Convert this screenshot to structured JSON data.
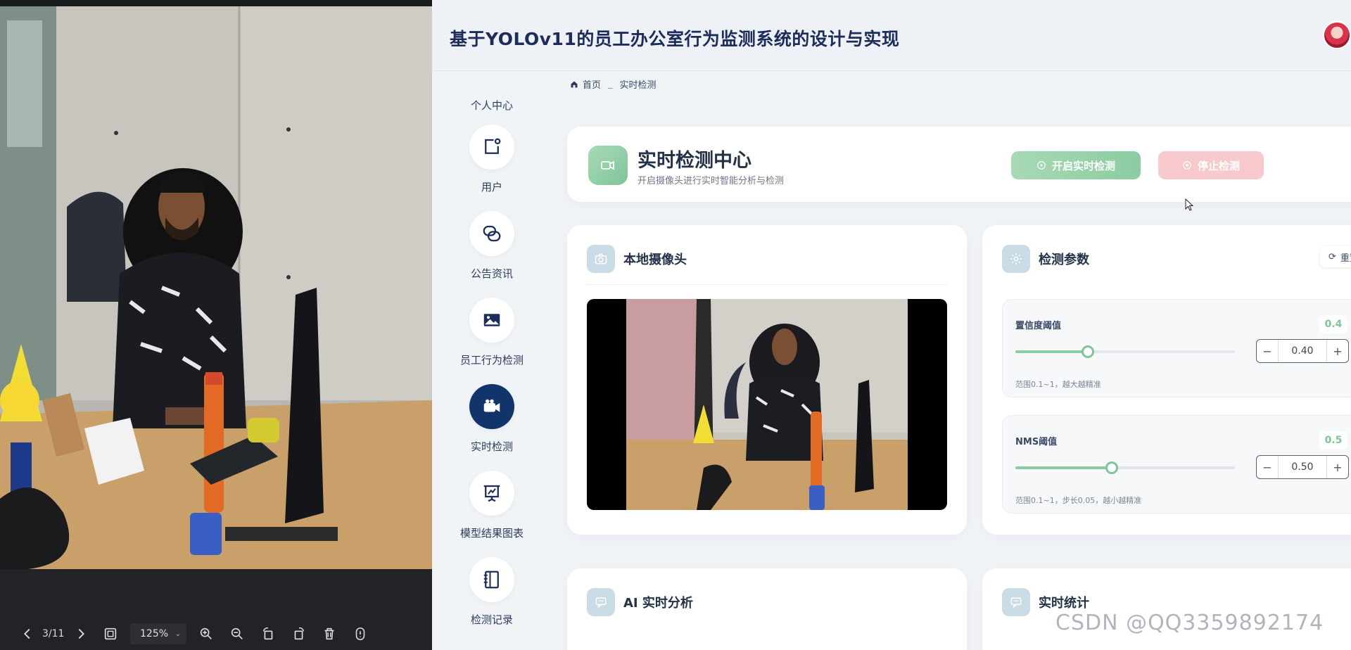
{
  "viewer": {
    "page_indicator": "3/11",
    "zoom": "125%",
    "toolbar_icons": [
      "chevron-left-icon",
      "chevron-right-icon",
      "fit-screen-icon",
      "zoom-in-icon",
      "zoom-out-icon",
      "rotate-left-icon",
      "rotate-right-icon",
      "delete-icon",
      "info-icon"
    ]
  },
  "header": {
    "title": "基于YOLOv11的员工办公室行为监测系统的设计与实现"
  },
  "sidebar": {
    "personal": "个人中心",
    "items": [
      {
        "label": "用户",
        "icon": "user-edit-icon",
        "active": false
      },
      {
        "label": "公告资讯",
        "icon": "link-icon",
        "active": false
      },
      {
        "label": "员工行为检测",
        "icon": "image-icon",
        "active": false
      },
      {
        "label": "实时检测",
        "icon": "video-camera-icon",
        "active": true
      },
      {
        "label": "模型结果图表",
        "icon": "presentation-chart-icon",
        "active": false
      },
      {
        "label": "检测记录",
        "icon": "notebook-icon",
        "active": false
      }
    ]
  },
  "breadcrumb": {
    "home": "首页",
    "separator": "_",
    "current": "实时检测"
  },
  "hero": {
    "title": "实时检测中心",
    "subtitle": "开启摄像头进行实时智能分析与检测",
    "start_button": "开启实时检测",
    "stop_button": "停止检测"
  },
  "camera_card": {
    "title": "本地摄像头"
  },
  "params_card": {
    "title": "检测参数",
    "reset_button": "重置",
    "confidence": {
      "name": "置信度阈值",
      "badge": "0.4",
      "input_value": "0.40",
      "hint": "范围0.1~1，越大越精准",
      "slider_fraction": 0.33
    },
    "nms": {
      "name": "NMS阈值",
      "badge": "0.5",
      "input_value": "0.50",
      "hint": "范围0.1~1，步长0.05，越小越精准",
      "slider_fraction": 0.44
    }
  },
  "ai_card": {
    "title": "AI 实时分析"
  },
  "stats_card": {
    "title": "实时统计"
  },
  "watermark": "CSDN @QQ3359892174",
  "colors": {
    "accent_green": "#8ccca1",
    "stop_pink": "#f7c9cc",
    "active_nav": "#11346a",
    "title_navy": "#1c2d5c"
  }
}
